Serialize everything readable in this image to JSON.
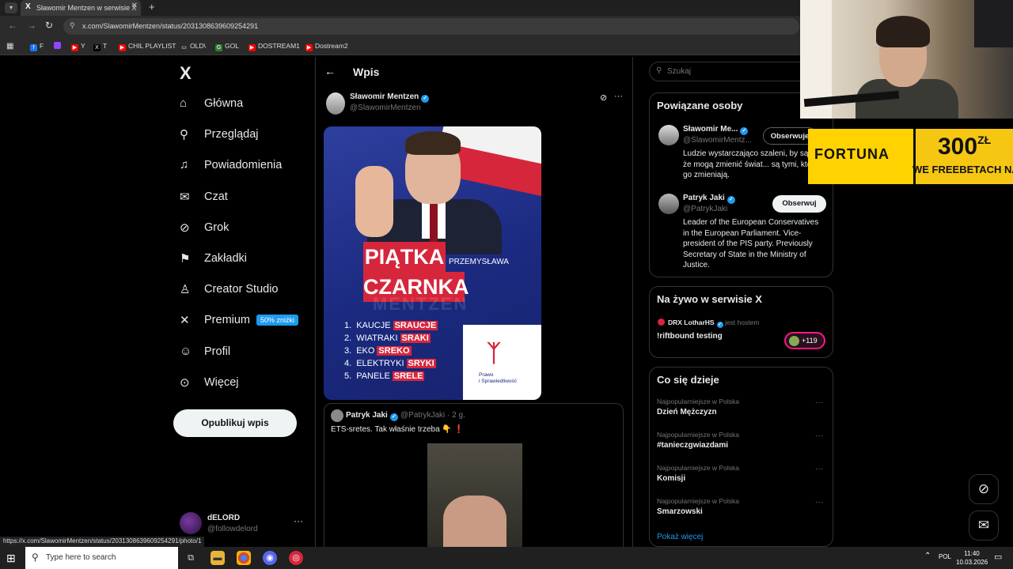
{
  "browser": {
    "tab_title": "Sławomir Mentzen w serwisie X",
    "tab_icon": "X",
    "tab_close": "✕",
    "new_tab": "+",
    "url": "x.com/SlawomirMentzen/status/2031308639609254291",
    "bookmarks": [
      {
        "label": "F",
        "color": "#1877f2",
        "icon": "f"
      },
      {
        "label": "",
        "color": "#9146ff",
        "icon": ""
      },
      {
        "label": "Y",
        "color": "#ff0000",
        "icon": "▶"
      },
      {
        "label": "T",
        "color": "#000000",
        "icon": "X"
      },
      {
        "label": "CHIL PLAYLIST",
        "color": "#ff0000",
        "icon": "▶"
      },
      {
        "label": "OLD\\",
        "color": "#00000000",
        "icon": "▭"
      },
      {
        "label": "GOL",
        "color": "#2e7d32",
        "icon": "G"
      },
      {
        "label": "DOSTREAM1",
        "color": "#ff0000",
        "icon": "▶"
      },
      {
        "label": "Dostream2",
        "color": "#ff0000",
        "icon": "▶"
      }
    ]
  },
  "sidebar": {
    "logo": "X",
    "items": [
      {
        "label": "Główna",
        "icon": "home-icon"
      },
      {
        "label": "Przeglądaj",
        "icon": "search-icon"
      },
      {
        "label": "Powiadomienia",
        "icon": "bell-icon"
      },
      {
        "label": "Czat",
        "icon": "mail-icon"
      },
      {
        "label": "Grok",
        "icon": "grok-icon"
      },
      {
        "label": "Zakładki",
        "icon": "bookmark-icon"
      },
      {
        "label": "Creator Studio",
        "icon": "creator-icon"
      },
      {
        "label": "Premium",
        "icon": "x-icon",
        "badge": "50% zniżki"
      },
      {
        "label": "Profil",
        "icon": "person-icon"
      },
      {
        "label": "Więcej",
        "icon": "more-circle-icon"
      }
    ],
    "post_button": "Opublikuj wpis",
    "account": {
      "name": "dELORD",
      "handle": "@followdelord",
      "more": "···"
    }
  },
  "main": {
    "back": "←",
    "title": "Wpis",
    "author_name": "Sławomir Mentzen",
    "author_handle": "@SlawomirMentzen",
    "verified_mark": "✓",
    "poster": {
      "line1": "PIĄTKA",
      "line2": "CZARNKA",
      "subtitle": "PRZEMYSŁAWA",
      "watermark": "MENTZEN",
      "items": [
        {
          "num": "1.",
          "text": "KAUCJE",
          "hl": "SRAUCJE"
        },
        {
          "num": "2.",
          "text": "WIATRAKI",
          "hl": "SRAKI"
        },
        {
          "num": "3.",
          "text": "EKO",
          "hl": "SREKO"
        },
        {
          "num": "4.",
          "text": "ELEKTRYKI",
          "hl": "SRYKI"
        },
        {
          "num": "5.",
          "text": "PANELE",
          "hl": "SRELE"
        }
      ],
      "party": "Prawo\ni Sprawiedliwość"
    },
    "quote": {
      "name": "Patryk Jaki",
      "handle": "@PatrykJaki · 2 g.",
      "text": "ETS-sretes. Tak właśnie trzeba 👇 ❗"
    }
  },
  "right": {
    "search_placeholder": "Szukaj",
    "related_title": "Powiązane osoby",
    "related": [
      {
        "name": "Sławomir Me...",
        "handle": "@SlawomirMentz...",
        "button": "Obserwuje",
        "bio": "Ludzie wystarczająco szaleni, by sądzić, że mogą zmienić świat... są tymi, którzy go zmieniają."
      },
      {
        "name": "Patryk Jaki",
        "handle": "@PatrykJaki",
        "button": "Obserwuj",
        "bio": "Leader of the European Conservatives in the European Parliament. Vice-president of the PIS party. Previously Secretary of State in the Ministry of Justice."
      }
    ],
    "live_title": "Na żywo w serwisie X",
    "live": {
      "host": "DRX LotharHS",
      "role": "jest hostem",
      "title": "!riftbound testing",
      "count": "+119"
    },
    "trends_title": "Co się dzieje",
    "trends": [
      {
        "context": "Najpopularniejsze w Polska",
        "name": "Dzień Mężczyzn"
      },
      {
        "context": "Najpopularniejsze w Polska",
        "name": "#tanieczgwiazdami"
      },
      {
        "context": "Najpopularniejsze w Polska",
        "name": "Komisji"
      },
      {
        "context": "Najpopularniejsze w Polska",
        "name": "Smarzowski"
      }
    ],
    "trend_more": "···",
    "show_more": "Pokaż więcej"
  },
  "ad": {
    "brand": "FORTUNA",
    "amount": "300",
    "currency": "ZŁ",
    "promo": "WE FREEBETACH NA STA"
  },
  "status_url": "https://x.com/SlawomirMentzen/status/2031308639609254291/photo/1",
  "taskbar": {
    "search_placeholder": "Type here to search",
    "lang": "POL",
    "time": "11:40",
    "date": "10.03.2026"
  },
  "colors": {
    "accent": "#1d9bf0",
    "poster_red": "#d6263c",
    "bg": "#000000"
  }
}
